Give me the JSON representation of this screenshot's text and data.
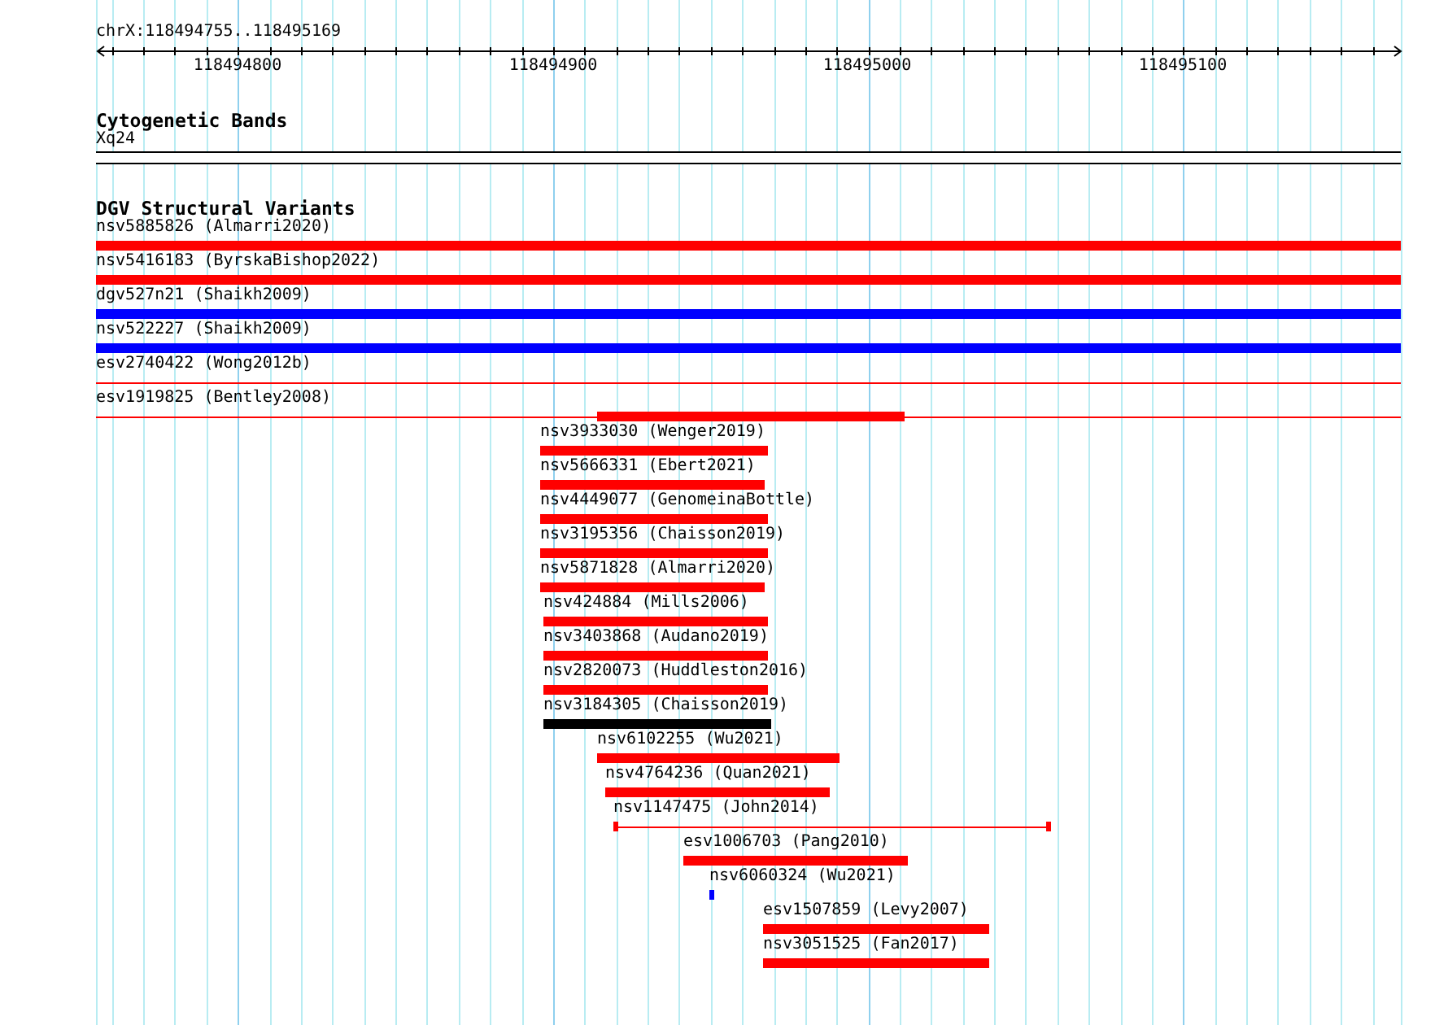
{
  "region": {
    "title": "chrX:118494755..118495169"
  },
  "ruler": {
    "ticks": [
      "118494800",
      "118494900",
      "118495000",
      "118495100"
    ]
  },
  "cytogenetic_bands": {
    "heading": "Cytogenetic Bands",
    "band": "Xq24"
  },
  "structural_variants": {
    "heading": "DGV Structural Variants",
    "features": [
      {
        "label": "nsv5885826 (Almarri2020)",
        "color": "#ff0000",
        "kind": "bar"
      },
      {
        "label": "nsv5416183 (ByrskaBishop2022)",
        "color": "#ff0000",
        "kind": "bar"
      },
      {
        "label": "dgv527n21 (Shaikh2009)",
        "color": "#0000ff",
        "kind": "bar"
      },
      {
        "label": "nsv522227 (Shaikh2009)",
        "color": "#0000ff",
        "kind": "bar"
      },
      {
        "label": "esv2740422 (Wong2012b)",
        "color": "#ff0000",
        "kind": "line"
      },
      {
        "label": "esv1919825 (Bentley2008)",
        "color": "#ff0000",
        "kind": "line"
      },
      {
        "label": "nsv3933030 (Wenger2019)",
        "color": "#ff0000",
        "kind": "bar"
      },
      {
        "label": "nsv5666331 (Ebert2021)",
        "color": "#ff0000",
        "kind": "bar"
      },
      {
        "label": "nsv4449077 (GenomeinaBottle)",
        "color": "#ff0000",
        "kind": "bar"
      },
      {
        "label": "nsv3195356 (Chaisson2019)",
        "color": "#ff0000",
        "kind": "bar"
      },
      {
        "label": "nsv5871828 (Almarri2020)",
        "color": "#ff0000",
        "kind": "bar"
      },
      {
        "label": "nsv424884 (Mills2006)",
        "color": "#ff0000",
        "kind": "bar"
      },
      {
        "label": "nsv3403868 (Audano2019)",
        "color": "#ff0000",
        "kind": "bar"
      },
      {
        "label": "nsv2820073 (Huddleston2016)",
        "color": "#ff0000",
        "kind": "bar"
      },
      {
        "label": "nsv3184305 (Chaisson2019)",
        "color": "#000000",
        "kind": "bar"
      },
      {
        "label": "nsv6102255 (Wu2021)",
        "color": "#ff0000",
        "kind": "bar"
      },
      {
        "label": "nsv4764236 (Quan2021)",
        "color": "#ff0000",
        "kind": "bar"
      },
      {
        "label": "nsv1147475 (John2014)",
        "color": "#ff0000",
        "kind": "bracket"
      },
      {
        "label": "esv1006703 (Pang2010)",
        "color": "#ff0000",
        "kind": "bar"
      },
      {
        "label": "nsv6060324 (Wu2021)",
        "color": "#0000ff",
        "kind": "bar"
      },
      {
        "label": "esv1507859 (Levy2007)",
        "color": "#ff0000",
        "kind": "bar"
      },
      {
        "label": "nsv3051525 (Fan2017)",
        "color": "#ff0000",
        "kind": "bar"
      }
    ]
  }
}
